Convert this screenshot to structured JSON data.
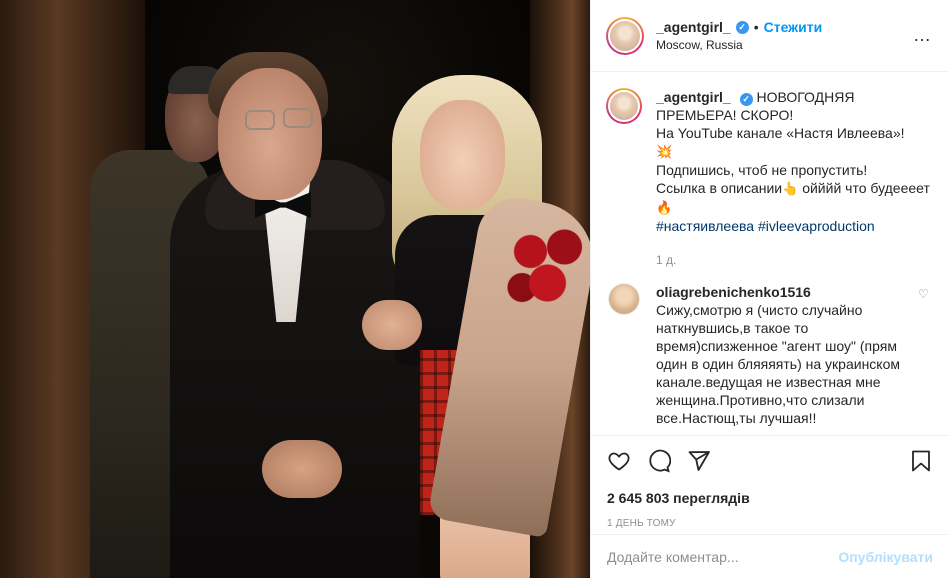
{
  "header": {
    "username": "_agentgirl_",
    "separator": "•",
    "follow_label": "Стежити",
    "location": "Moscow, Russia",
    "more_icon": "…"
  },
  "caption": {
    "username": "_agentgirl_",
    "line1": "НОВОГОДНЯЯ ПРЕМЬЕРА! СКОРО!",
    "line2": "На YouTube канале «Настя Ивлеева»!",
    "emoji1": "💥",
    "line3": "Подпишись, чтоб не пропустить!",
    "line4a": "Ссылка в описании",
    "emoji2": "👆",
    "line4b": " ойййй что будеееет",
    "emoji3": "🔥",
    "hashtag1": "#настяивлеева",
    "hashtag2": "#ivleevaproduction",
    "time": "1 д."
  },
  "comment": {
    "username": "oliagrebenichenko1516",
    "text": "Сижу,смотрю я (чисто случайно наткнувшись,в такое то время)спизженное \"агент шоу\" (прям один в один бляяяять) на украинском канале.ведущая не известная мне женщина.Противно,что слизали все.Настющ,ты лучшая!!"
  },
  "actions": {
    "icons": [
      "heart-icon",
      "comment-icon",
      "share-icon",
      "bookmark-icon"
    ],
    "views": "2 645 803 переглядів",
    "posted": "1 день тому"
  },
  "add_comment": {
    "placeholder": "Додайте коментар...",
    "publish_label": "Опублікувати"
  },
  "colors": {
    "link": "#0095f6",
    "verified": "#3897f0",
    "hashtag": "#00376b",
    "muted": "#8e8e8e",
    "publish_disabled": "#b2dffc"
  }
}
